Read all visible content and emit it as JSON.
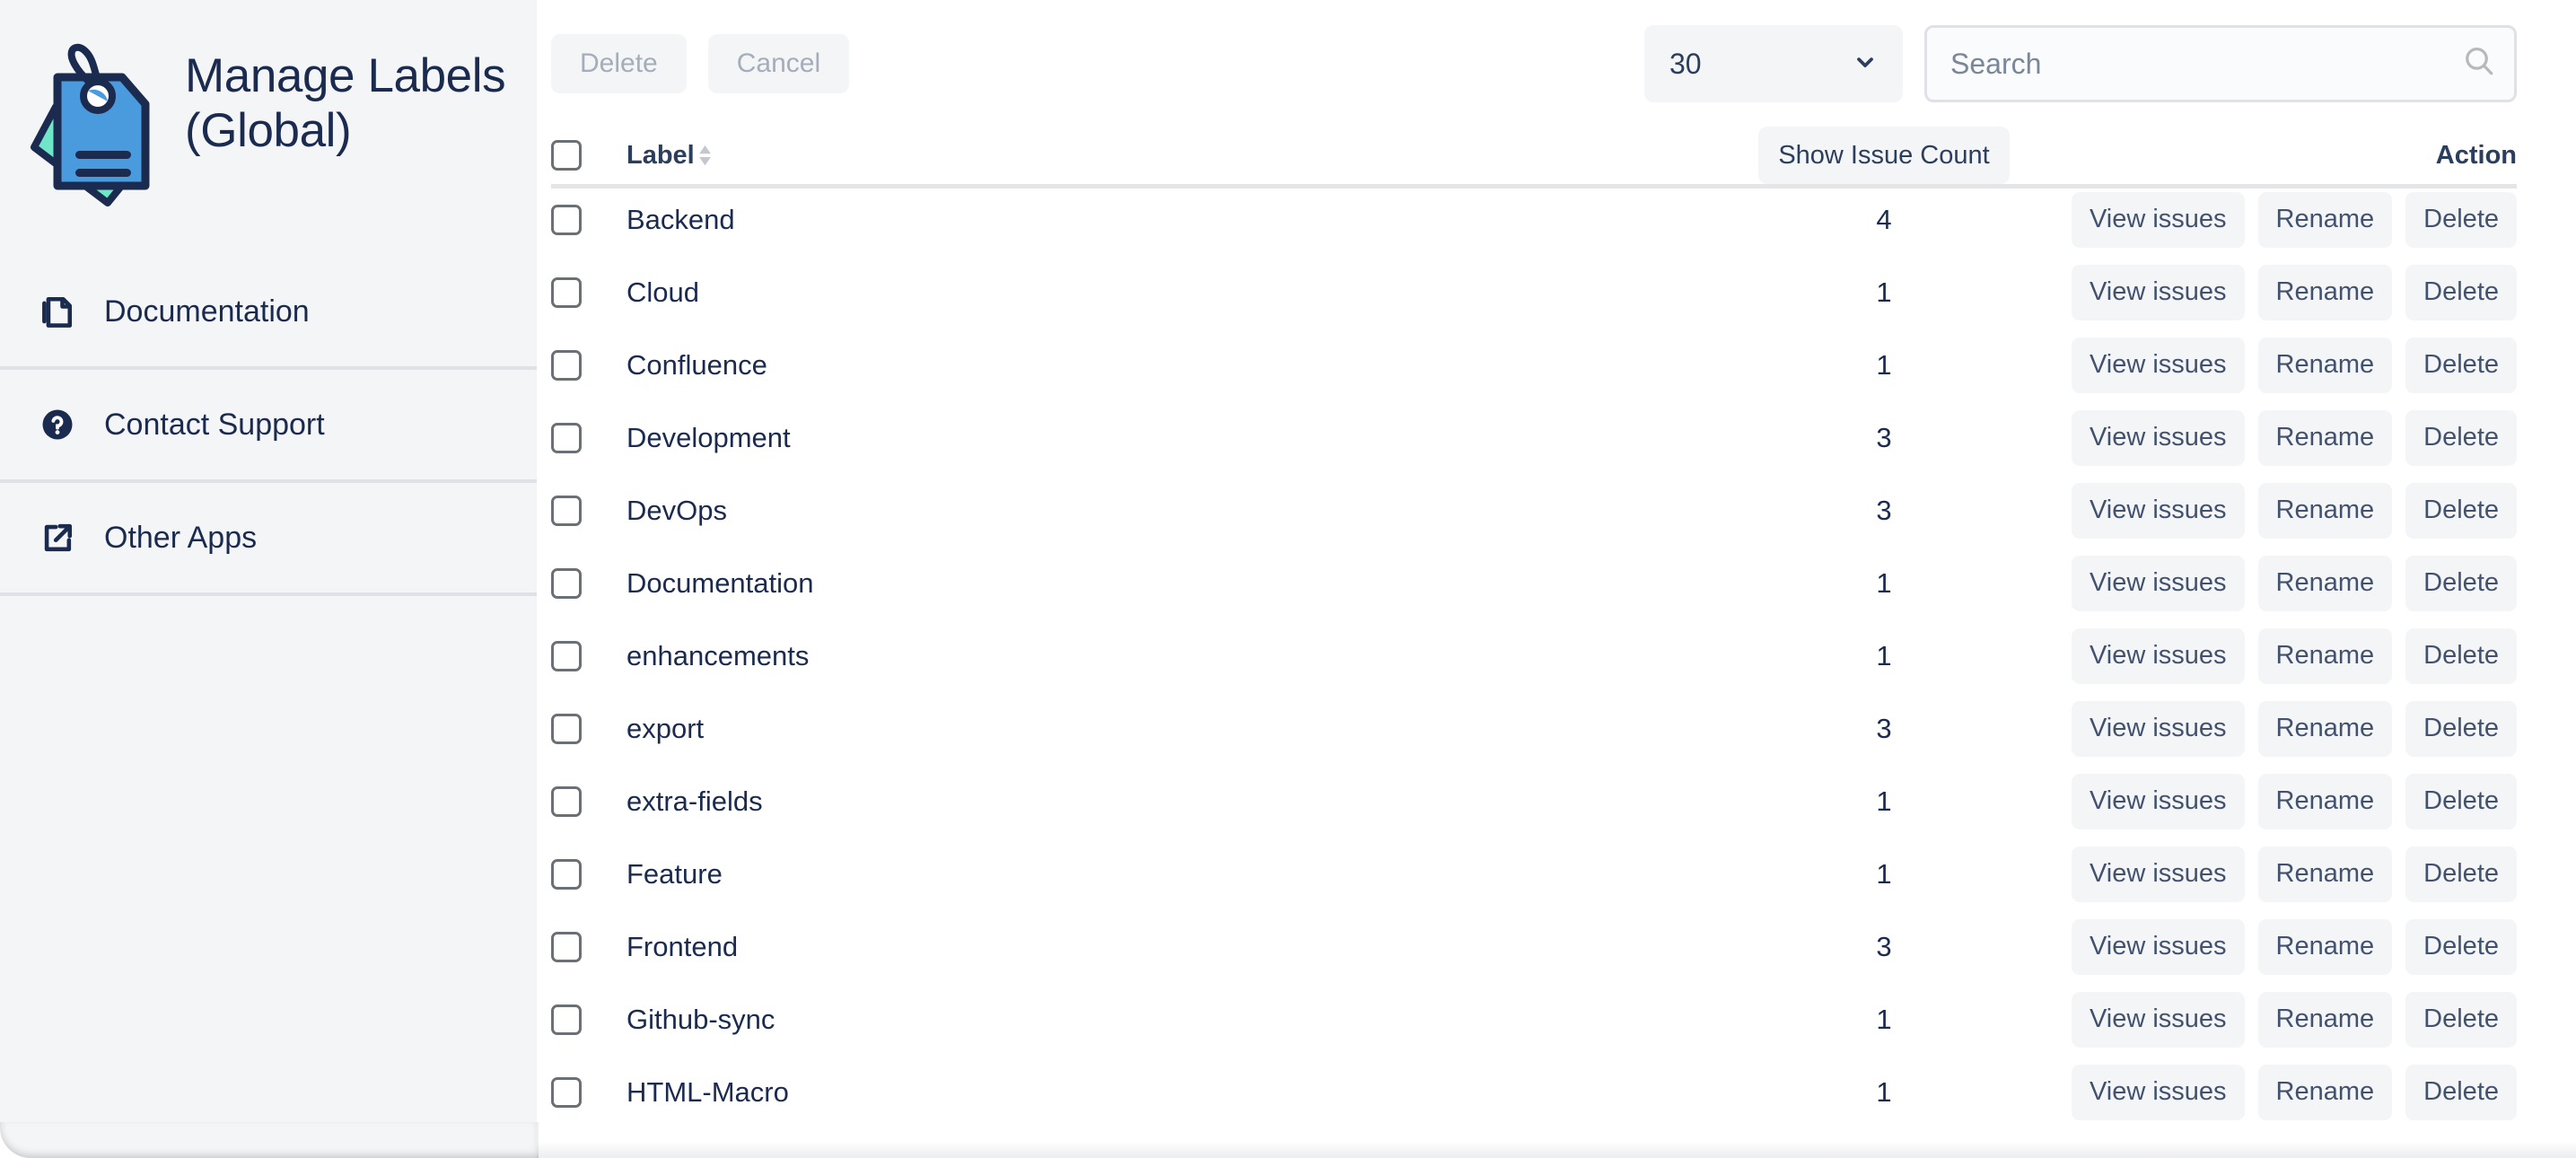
{
  "sidebar": {
    "logo_icon": "tag-logo-icon",
    "title": "Manage Labels (Global)",
    "items": [
      {
        "label": "Documentation",
        "icon": "documents-icon"
      },
      {
        "label": "Contact Support",
        "icon": "question-circle-icon"
      },
      {
        "label": "Other Apps",
        "icon": "external-link-icon"
      }
    ],
    "colors": {
      "background": "#f4f5f7",
      "divider": "#dfe1e6",
      "text": "#1b2b50",
      "logo_blue": "#4a9ade",
      "logo_teal": "#6fe6c8",
      "logo_outline": "#1b2b50"
    }
  },
  "toolbar": {
    "delete_label": "Delete",
    "cancel_label": "Cancel",
    "delete_disabled": true,
    "cancel_disabled": true,
    "page_size_value": "30",
    "page_size_options": [
      "30"
    ],
    "page_size_icon": "chevron-down-icon",
    "search_value": "",
    "search_placeholder": "Search",
    "search_icon": "search-icon"
  },
  "table": {
    "headers": {
      "select_all": "",
      "label": "Label",
      "label_sort_icon": "sort-arrows-icon",
      "issue_count_button": "Show Issue Count",
      "action": "Action"
    },
    "row_actions": {
      "view_issues": "View issues",
      "rename": "Rename",
      "delete": "Delete"
    },
    "rows": [
      {
        "label": "Backend",
        "count": "4"
      },
      {
        "label": "Cloud",
        "count": "1"
      },
      {
        "label": "Confluence",
        "count": "1"
      },
      {
        "label": "Development",
        "count": "3"
      },
      {
        "label": "DevOps",
        "count": "3"
      },
      {
        "label": "Documentation",
        "count": "1"
      },
      {
        "label": "enhancements",
        "count": "1"
      },
      {
        "label": "export",
        "count": "3"
      },
      {
        "label": "extra-fields",
        "count": "1"
      },
      {
        "label": "Feature",
        "count": "1"
      },
      {
        "label": "Frontend",
        "count": "3"
      },
      {
        "label": "Github-sync",
        "count": "1"
      },
      {
        "label": "HTML-Macro",
        "count": "1"
      }
    ]
  },
  "colors": {
    "accent": "#4a9ade",
    "text_primary": "#1b2b50",
    "text_secondary": "#42526e",
    "text_disabled": "#a5adba",
    "surface": "#f4f5f7",
    "border": "#dfe1e6"
  }
}
